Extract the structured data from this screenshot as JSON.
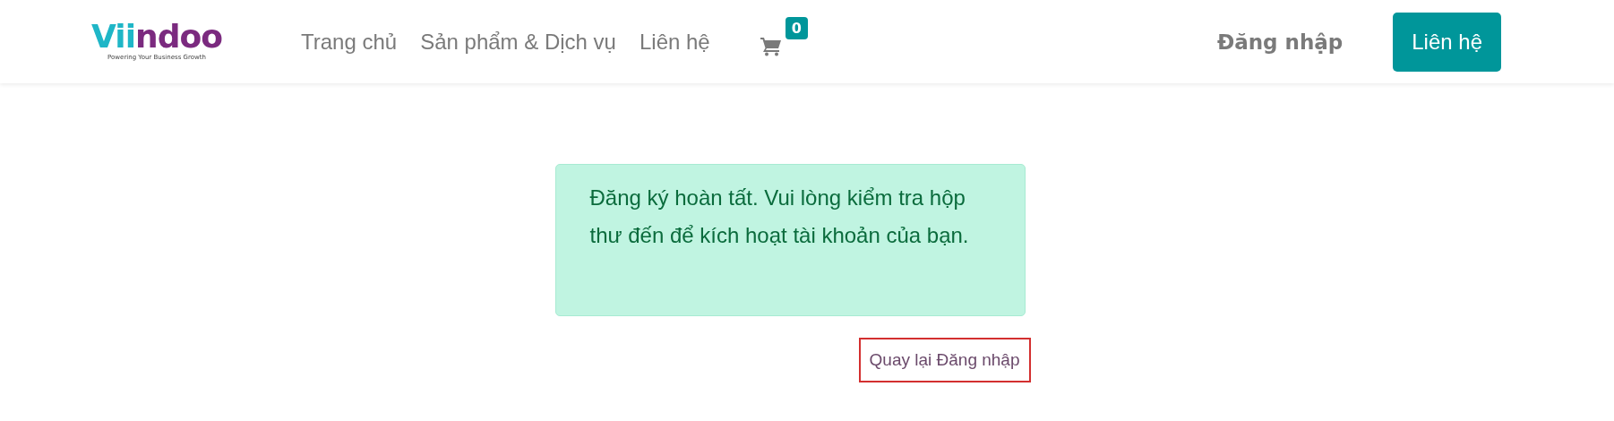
{
  "logo": {
    "name_part1": "Vii",
    "name_part2": "ndoo",
    "tagline": "Powering Your Business Growth"
  },
  "nav": [
    {
      "label": "Trang chủ"
    },
    {
      "label": "Sản phẩm & Dịch vụ"
    },
    {
      "label": "Liên hệ"
    }
  ],
  "cart": {
    "count": "0"
  },
  "login_link": "Đăng nhập",
  "contact_button": "Liên hệ",
  "alert": {
    "message": "Đăng ký hoàn tất. Vui lòng kiểm tra hộp thư đến để kích hoạt tài khoản của bạn."
  },
  "back_link": {
    "label": "Quay lại Đăng nhập",
    "highlighted": true
  }
}
